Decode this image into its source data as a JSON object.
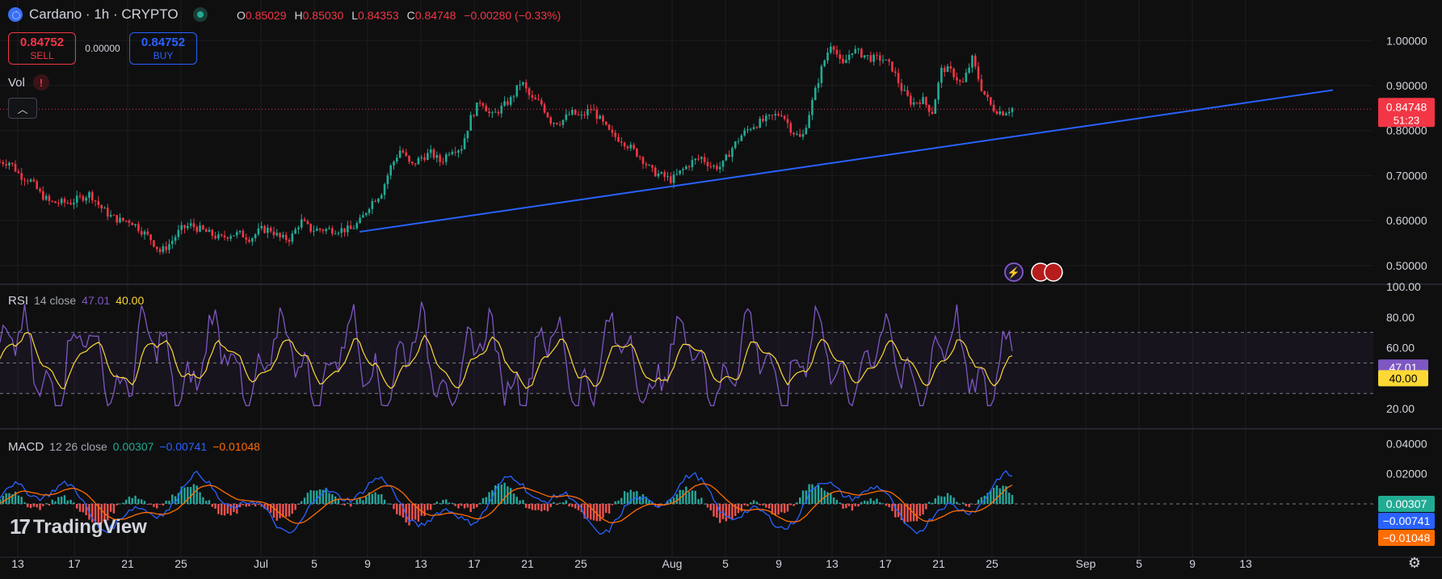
{
  "header": {
    "symbol": "Cardano · 1h · CRYPTO",
    "ohlc": {
      "o_key": "O",
      "o": "0.85029",
      "h_key": "H",
      "h": "0.85030",
      "l_key": "L",
      "l": "0.84353",
      "c_key": "C",
      "c": "0.84748",
      "change": "−0.00280 (−0.33%)"
    }
  },
  "trade": {
    "sell_price": "0.84752",
    "sell_label": "SELL",
    "spread": "0.00000",
    "buy_price": "0.84752",
    "buy_label": "BUY"
  },
  "vol": {
    "label": "Vol",
    "warn": "!"
  },
  "rsi_legend": {
    "name": "RSI",
    "params": "14 close",
    "v1": "47.01",
    "v2": "40.00"
  },
  "macd_legend": {
    "name": "MACD",
    "params": "12 26 close",
    "v1": "0.00307",
    "v2": "−0.00741",
    "v3": "−0.01048"
  },
  "logo": {
    "text": "TradingView"
  },
  "colors": {
    "bg": "#0f0f10",
    "up": "#22ab94",
    "down": "#f23645",
    "trend": "#2962ff",
    "rsi": "#7e57c2",
    "rsi_ma": "#fdd835",
    "macd": "#2962ff",
    "signal": "#ff6d00",
    "axis_text": "#d1d4dc"
  },
  "chart_data": {
    "type": "candlestick",
    "symbol": "Cardano",
    "interval": "1h",
    "x_ticks": [
      "13",
      "17",
      "21",
      "25",
      "Jul",
      "5",
      "9",
      "13",
      "17",
      "21",
      "25",
      "Aug",
      "5",
      "9",
      "13",
      "17",
      "21",
      "25",
      "Sep",
      "5",
      "9",
      "13"
    ],
    "price_axis": {
      "ticks": [
        "1.00000",
        "0.90000",
        "0.80000",
        "0.70000",
        "0.60000",
        "0.50000"
      ],
      "range": [
        0.48,
        1.04
      ]
    },
    "last_price": {
      "value": "0.84748",
      "countdown": "51:23"
    },
    "price_path": [
      [
        0.73,
        0.73
      ],
      [
        0.7,
        0.69
      ],
      [
        0.66,
        0.64
      ],
      [
        0.64,
        0.64
      ],
      [
        0.65,
        0.66
      ],
      [
        0.63,
        0.61
      ],
      [
        0.6,
        0.6
      ],
      [
        0.58,
        0.56
      ],
      [
        0.53,
        0.55
      ],
      [
        0.58,
        0.59
      ],
      [
        0.58,
        0.57
      ],
      [
        0.56,
        0.57
      ],
      [
        0.57,
        0.56
      ],
      [
        0.58,
        0.58
      ],
      [
        0.56,
        0.56
      ],
      [
        0.6,
        0.58
      ],
      [
        0.58,
        0.58
      ],
      [
        0.58,
        0.58
      ],
      [
        0.6,
        0.64
      ],
      [
        0.66,
        0.72
      ],
      [
        0.76,
        0.72
      ],
      [
        0.74,
        0.75
      ],
      [
        0.73,
        0.76
      ],
      [
        0.76,
        0.83
      ],
      [
        0.87,
        0.83
      ],
      [
        0.85,
        0.87
      ],
      [
        0.91,
        0.87
      ],
      [
        0.86,
        0.82
      ],
      [
        0.82,
        0.84
      ],
      [
        0.83,
        0.85
      ],
      [
        0.82,
        0.79
      ],
      [
        0.78,
        0.76
      ],
      [
        0.74,
        0.71
      ],
      [
        0.7,
        0.69
      ],
      [
        0.71,
        0.73
      ],
      [
        0.74,
        0.72
      ],
      [
        0.72,
        0.76
      ],
      [
        0.79,
        0.81
      ],
      [
        0.82,
        0.83
      ],
      [
        0.84,
        0.8
      ],
      [
        0.78,
        0.86
      ],
      [
        0.94,
        1.0
      ],
      [
        0.94,
        0.98
      ],
      [
        0.97,
        0.96
      ],
      [
        0.96,
        0.94
      ],
      [
        0.89,
        0.86
      ],
      [
        0.87,
        0.84
      ],
      [
        0.94,
        0.93
      ],
      [
        0.9,
        0.96
      ],
      [
        0.89,
        0.85
      ],
      [
        0.84,
        0.85
      ]
    ],
    "trendline": {
      "from": {
        "date": "Jul 7",
        "price": 0.575
      },
      "to": {
        "date": "Sep 11",
        "price": 0.89
      }
    },
    "rsi": {
      "axis_ticks": [
        "100.00",
        "80.00",
        "60.00",
        "20.00"
      ],
      "range": [
        10,
        100
      ],
      "band": [
        30,
        70
      ],
      "mid": 50,
      "last": 47.01,
      "ma_last": 40.0
    },
    "macd": {
      "axis_ticks": [
        "0.04000",
        "0.02000"
      ],
      "range": [
        -0.03,
        0.045
      ],
      "macd_last": 0.00307,
      "signal_last": -0.00741,
      "hist_last": -0.01048
    }
  }
}
